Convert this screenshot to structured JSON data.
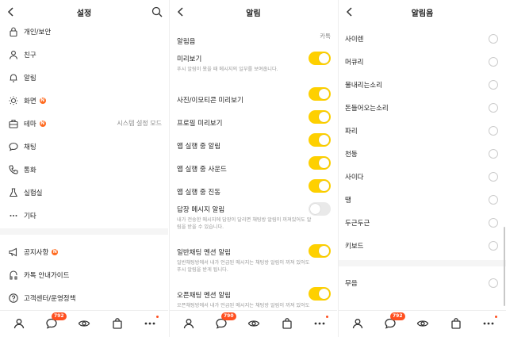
{
  "settings": {
    "title": "설정",
    "items": [
      {
        "label": "개인/보안",
        "icon": "lock-icon"
      },
      {
        "label": "친구",
        "icon": "person-icon"
      },
      {
        "label": "알림",
        "icon": "bell-icon"
      },
      {
        "label": "화면",
        "icon": "brightness-icon",
        "badge": "N"
      },
      {
        "label": "테마",
        "icon": "theme-icon",
        "badge": "N",
        "value": "시스템 설정 모드"
      },
      {
        "label": "채팅",
        "icon": "chat-icon"
      },
      {
        "label": "통화",
        "icon": "phone-icon"
      },
      {
        "label": "실험실",
        "icon": "flask-icon"
      },
      {
        "label": "기타",
        "icon": "more-icon"
      },
      {
        "label": "공지사항",
        "icon": "megaphone-icon",
        "badge": "N"
      },
      {
        "label": "카톡 안내가이드",
        "icon": "guide-icon"
      },
      {
        "label": "고객센터/운영정책",
        "icon": "help-icon"
      }
    ]
  },
  "notifications": {
    "title": "알림",
    "sound_label": "알림음",
    "sound_value": "카톡",
    "preview": {
      "label": "미리보기",
      "desc": "푸시 알림이 왔을 때 메시지의 일부를 보여줍니다.",
      "on": true
    },
    "toggles": [
      {
        "label": "사진/이모티콘 미리보기",
        "on": true
      },
      {
        "label": "프로필 미리보기",
        "on": true
      },
      {
        "label": "앱 실행 중 알림",
        "on": true
      },
      {
        "label": "앱 실행 중 사운드",
        "on": true
      },
      {
        "label": "앱 실행 중 진동",
        "on": true
      }
    ],
    "reply": {
      "label": "답장 메시지 알림",
      "desc": "내가 전송한 메시지에 답장이 달리면 채팅방 알림이 꺼져있어도 알림을 받을 수 있습니다.",
      "on": false
    },
    "mention": {
      "label": "일반채팅 멘션 알림",
      "desc": "일반채팅방에서 내가 언급된 메시지는 채팅방 알림이 꺼져 있어도 푸시 알림을 받게 됩니다.",
      "on": true
    },
    "open_mention": {
      "label": "오픈채팅 멘션 알림",
      "desc": "오픈채팅방에서 내가 언급된 메시지는 채팅방 알림이 꺼져 있어도",
      "on": true
    }
  },
  "sounds": {
    "title": "알림음",
    "options": [
      "사이렌",
      "머큐리",
      "물내리는소리",
      "돈들어오는소리",
      "파리",
      "천둥",
      "사이다",
      "땡",
      "두근두근",
      "키보드"
    ],
    "mute": "무음"
  },
  "tabbar": {
    "items": [
      {
        "name": "friends-tab",
        "icon": "person-icon"
      },
      {
        "name": "chats-tab",
        "icon": "chat-icon"
      },
      {
        "name": "view-tab",
        "icon": "eye-icon"
      },
      {
        "name": "shopping-tab",
        "icon": "bag-icon"
      },
      {
        "name": "more-tab",
        "icon": "more-icon"
      }
    ],
    "badges": [
      "792",
      "790",
      "792"
    ]
  },
  "colors": {
    "accent": "#fed000",
    "badge": "#ff4f1f",
    "new_badge": "#ff6a1f"
  }
}
